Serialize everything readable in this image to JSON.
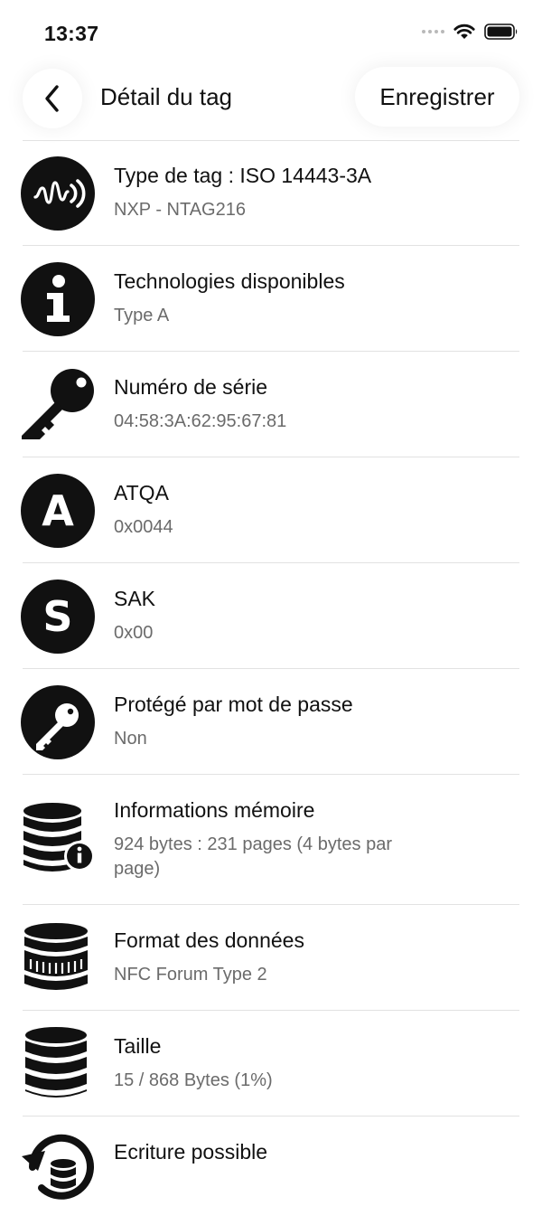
{
  "status_bar": {
    "time": "13:37"
  },
  "header": {
    "title": "Détail du tag",
    "save_label": "Enregistrer"
  },
  "items": [
    {
      "title": "Type de tag : ISO 14443-3A",
      "value": "NXP - NTAG216",
      "icon": "nfc-signal-icon"
    },
    {
      "title": "Technologies disponibles",
      "value": "Type A",
      "icon": "info-icon"
    },
    {
      "title": "Numéro de série",
      "value": "04:58:3A:62:95:67:81",
      "icon": "key-icon"
    },
    {
      "title": "ATQA",
      "value": "0x0044",
      "icon": "letter-a-icon"
    },
    {
      "title": "SAK",
      "value": "0x00",
      "icon": "letter-s-icon"
    },
    {
      "title": "Protégé par mot de passe",
      "value": "Non",
      "icon": "lock-key-icon"
    },
    {
      "title": "Informations mémoire",
      "value": "924 bytes : 231 pages (4 bytes par page)",
      "icon": "database-info-icon"
    },
    {
      "title": "Format des données",
      "value": "NFC Forum Type 2",
      "icon": "coins-stack-icon"
    },
    {
      "title": "Taille",
      "value": "15 / 868 Bytes (1%)",
      "icon": "database-icon"
    },
    {
      "title": "Ecriture possible",
      "value": "",
      "icon": "database-rotate-icon"
    }
  ]
}
